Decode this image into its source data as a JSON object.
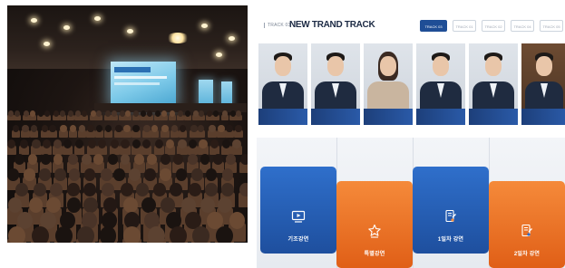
{
  "panel": {
    "track_label": "TRACK 03",
    "title": "NEW TRAND TRACK",
    "tabs": [
      "TRACK 03",
      "TRACK 01",
      "TRACK 02",
      "TRACK 04",
      "TRACK 05"
    ],
    "active_tab": 0
  },
  "speakers": [
    {
      "caption": ""
    },
    {
      "caption": ""
    },
    {
      "caption": ""
    },
    {
      "caption": ""
    },
    {
      "caption": ""
    },
    {
      "caption": ""
    }
  ],
  "cards": [
    {
      "label": "기조강연",
      "icon": "video-play-icon",
      "color": "blue"
    },
    {
      "label": "특별강연",
      "icon": "star-award-icon",
      "color": "orange"
    },
    {
      "label": "1일차 강연",
      "icon": "document-edit-icon",
      "color": "blue"
    },
    {
      "label": "2일차 강연",
      "icon": "document-edit-icon",
      "color": "orange"
    }
  ],
  "colors": {
    "accent_blue": "#1f4e96",
    "card_blue": "#2f6fcb",
    "card_orange": "#f58a3a",
    "title": "#1c2a44"
  }
}
